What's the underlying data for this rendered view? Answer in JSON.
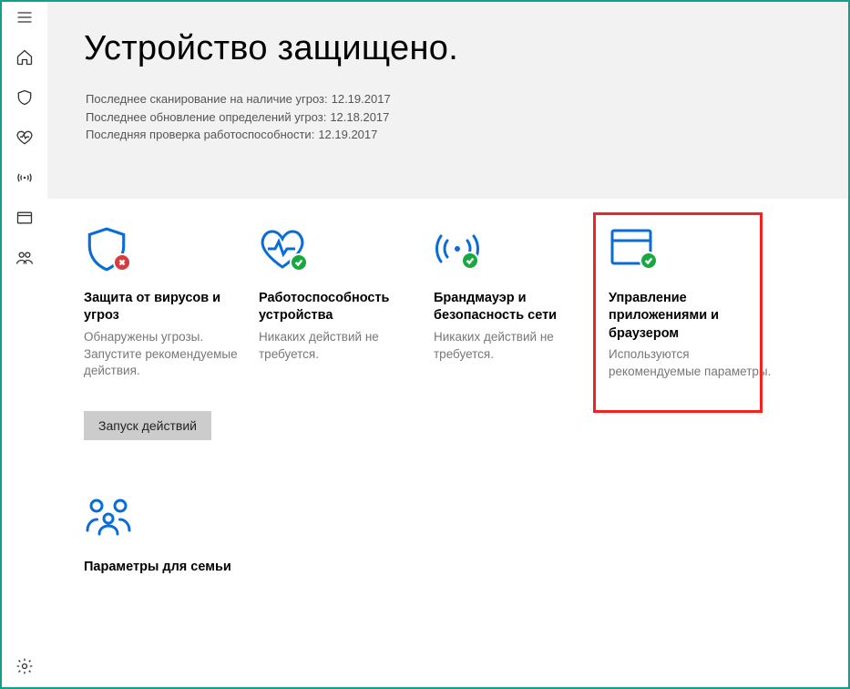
{
  "hero": {
    "title": "Устройство защищено.",
    "lines": [
      {
        "label": "Последнее сканирование на наличие угроз:",
        "date": "12.19.2017"
      },
      {
        "label": "Последнее обновление определений угроз:",
        "date": "12.18.2017"
      },
      {
        "label": "Последняя проверка работоспособности:",
        "date": "12.19.2017"
      }
    ]
  },
  "cards": {
    "virus": {
      "title": "Защита от вирусов и угроз",
      "desc": "Обнаружены угрозы. Запустите рекомендуемые действия.",
      "action": "Запуск действий"
    },
    "health": {
      "title": "Работоспособность устройства",
      "desc": "Никаких действий не требуется."
    },
    "firewall": {
      "title": "Брандмауэр и безопасность сети",
      "desc": "Никаких действий не требуется."
    },
    "appbrowser": {
      "title": "Управление приложениями и браузером",
      "desc": "Используются рекомендуемые параметры."
    },
    "family": {
      "title": "Параметры для семьи"
    }
  }
}
